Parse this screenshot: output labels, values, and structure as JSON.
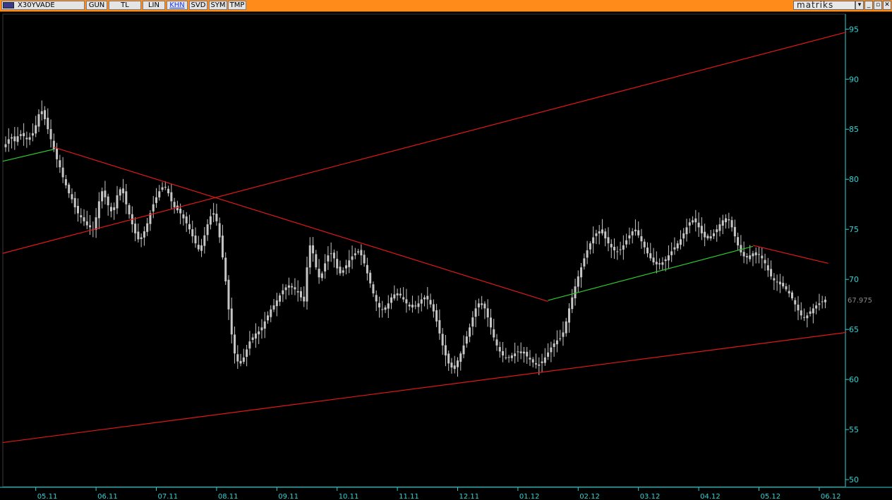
{
  "toolbar": {
    "symbol": "X30YVADE",
    "buttons": [
      {
        "label": "GUN",
        "active": false
      },
      {
        "label": "TL",
        "active": false
      },
      {
        "label": "LIN",
        "active": false
      },
      {
        "label": "KHN",
        "active": true
      },
      {
        "label": "SVD",
        "active": false
      },
      {
        "label": "SYM",
        "active": false
      },
      {
        "label": "TMP",
        "active": false
      }
    ],
    "brand": "matriks",
    "window_buttons": [
      {
        "name": "dropdown",
        "glyph": "▾"
      },
      {
        "name": "minimize",
        "glyph": "_"
      },
      {
        "name": "restore",
        "glyph": "▫"
      },
      {
        "name": "close",
        "glyph": "✕"
      }
    ]
  },
  "chart_data": {
    "type": "candlestick",
    "ylim": [
      49.3,
      96.5
    ],
    "yticks": [
      50,
      55,
      60,
      65,
      70,
      75,
      80,
      85,
      90,
      95
    ],
    "last_price": "67.975",
    "x_ticks": [
      "05.11",
      "06.11",
      "07.11",
      "08.11",
      "09.11",
      "10.11",
      "11.11",
      "12.11",
      "01.12",
      "02.12",
      "03.12",
      "04.12",
      "05.12",
      "06.12"
    ],
    "x_tick_index": [
      10,
      30,
      50,
      70,
      90,
      110,
      130,
      150,
      170,
      190,
      210,
      230,
      250,
      270
    ],
    "candle_count": 273,
    "closes": [
      83.5,
      84.0,
      84.2,
      83.8,
      84.3,
      84.5,
      84.3,
      84.0,
      84.2,
      84.6,
      85.4,
      86.5,
      86.8,
      86.0,
      85.0,
      84.0,
      83.0,
      82.0,
      81.2,
      80.2,
      79.4,
      78.6,
      78.0,
      77.2,
      76.6,
      76.2,
      75.8,
      75.4,
      75.2,
      75.0,
      76.2,
      77.8,
      78.8,
      78.2,
      77.4,
      76.8,
      77.2,
      78.4,
      79.0,
      78.6,
      77.5,
      76.5,
      75.5,
      74.6,
      74.0,
      74.2,
      74.8,
      75.6,
      76.6,
      77.5,
      78.2,
      78.8,
      79.2,
      79.2,
      78.6,
      77.8,
      77.2,
      76.9,
      76.6,
      76.1,
      75.6,
      75.0,
      74.3,
      73.6,
      73.0,
      73.4,
      74.4,
      75.5,
      76.3,
      76.6,
      75.8,
      74.2,
      72.2,
      69.8,
      67.0,
      64.5,
      62.6,
      61.8,
      61.6,
      62.2,
      63.0,
      63.8,
      64.2,
      64.6,
      64.8,
      65.2,
      65.8,
      66.4,
      67.0,
      67.4,
      67.9,
      68.4,
      68.9,
      69.2,
      69.4,
      69.2,
      69.0,
      68.7,
      68.2,
      67.8,
      71.2,
      73.4,
      72.6,
      71.2,
      70.2,
      70.6,
      71.6,
      72.4,
      72.6,
      72.1,
      71.1,
      70.6,
      70.9,
      71.4,
      71.9,
      72.3,
      72.6,
      72.8,
      72.4,
      71.6,
      70.6,
      69.6,
      68.6,
      67.8,
      67.2,
      67.0,
      67.2,
      67.6,
      68.2,
      68.5,
      68.6,
      68.4,
      68.0,
      67.6,
      67.3,
      67.2,
      67.3,
      67.6,
      68.0,
      68.2,
      68.0,
      67.5,
      66.8,
      65.8,
      64.6,
      63.4,
      62.4,
      61.6,
      61.2,
      61.4,
      61.9,
      62.6,
      63.4,
      64.3,
      65.2,
      66.2,
      67.1,
      67.6,
      67.6,
      67.1,
      66.2,
      65.2,
      64.2,
      63.4,
      62.8,
      62.4,
      62.2,
      62.2,
      62.4,
      62.6,
      62.8,
      62.8,
      62.6,
      62.3,
      62.0,
      61.7,
      61.5,
      61.5,
      61.8,
      62.2,
      62.7,
      63.2,
      63.6,
      63.9,
      64.1,
      64.7,
      65.8,
      67.1,
      68.2,
      69.3,
      70.3,
      71.2,
      72.1,
      72.9,
      73.6,
      74.2,
      74.6,
      74.8,
      74.6,
      74.1,
      73.6,
      73.2,
      72.9,
      72.8,
      73.0,
      73.4,
      73.9,
      74.4,
      74.8,
      74.8,
      74.4,
      73.8,
      73.2,
      72.6,
      72.1,
      71.7,
      71.5,
      71.5,
      71.7,
      72.0,
      72.4,
      72.8,
      73.2,
      73.6,
      74.0,
      74.6,
      75.2,
      75.7,
      75.9,
      75.7,
      75.2,
      74.6,
      74.2,
      74.1,
      74.3,
      74.6,
      75.0,
      75.5,
      75.9,
      76.1,
      75.9,
      75.2,
      74.3,
      73.4,
      72.7,
      72.3,
      72.2,
      72.4,
      72.6,
      72.7,
      72.5,
      72.1,
      71.6,
      70.9,
      70.3,
      69.9,
      69.7,
      69.5,
      69.3,
      69.0,
      68.6,
      68.1,
      67.5,
      66.9,
      66.4,
      66.2,
      66.4,
      66.8,
      67.1,
      67.4,
      67.6,
      67.8,
      67.975
    ],
    "trendlines": [
      {
        "color": "#e01818",
        "points": [
          [
            -1,
            72.6
          ],
          [
            279,
            94.7
          ]
        ]
      },
      {
        "color": "#e01818",
        "points": [
          [
            -1,
            53.7
          ],
          [
            279,
            64.7
          ]
        ]
      },
      {
        "color": "#e01818",
        "points": [
          [
            16,
            83.2
          ],
          [
            180,
            67.8
          ]
        ]
      },
      {
        "color": "#e01818",
        "points": [
          [
            248,
            73.4
          ],
          [
            273,
            71.6
          ]
        ]
      },
      {
        "color": "#2ec82e",
        "points": [
          [
            -1,
            81.8
          ],
          [
            16,
            83.0
          ]
        ]
      },
      {
        "color": "#2ec82e",
        "points": [
          [
            180,
            67.9
          ],
          [
            248,
            73.3
          ]
        ]
      }
    ],
    "colors": {
      "background": "#000000",
      "candle": "#c6c6c6",
      "axis": "#2fd3d3",
      "last_price": "#8a8a8a"
    }
  }
}
